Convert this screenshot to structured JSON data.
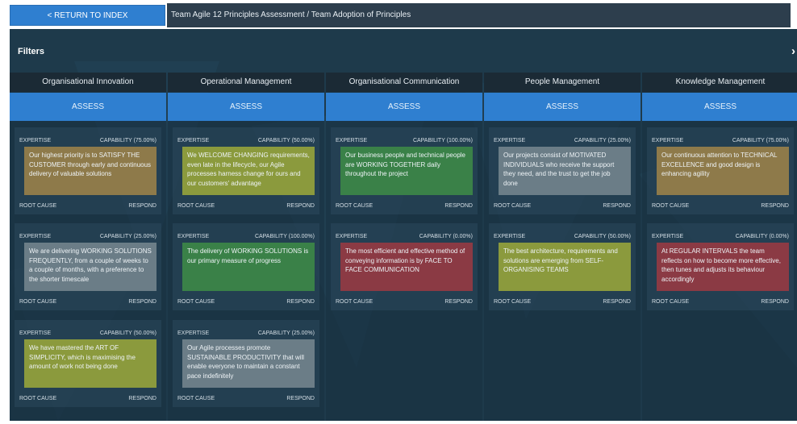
{
  "header": {
    "return_label": "< RETURN TO INDEX",
    "breadcrumb": "Team Agile 12 Principles Assessment / Team Adoption of Principles"
  },
  "filters": {
    "label": "Filters",
    "chevron": "›"
  },
  "labels": {
    "assess": "ASSESS",
    "expertise": "EXPERTISE",
    "root_cause": "ROOT CAUSE",
    "respond": "RESPOND"
  },
  "colors": {
    "blue": "#2f7fd0",
    "background": "#1e3a4b",
    "yellow": "#8b9a3d",
    "orange": "#8e7a4a",
    "green": "#3a8148",
    "red": "#8b3a44",
    "gray": "#6b7d87"
  },
  "columns": [
    {
      "title": "Organisational Innovation",
      "cards": [
        {
          "capability": "CAPABILITY (75.00%)",
          "statement": "Our highest priority is to SATISFY THE CUSTOMER through early and continuous delivery of valuable solutions",
          "color": "#8e7a4a"
        },
        {
          "capability": "CAPABILITY (25.00%)",
          "statement": "We are delivering WORKING SOLUTIONS FREQUENTLY, from a couple of weeks to a couple of months, with a preference to the shorter timescale",
          "color": "#6b7d87"
        },
        {
          "capability": "CAPABILITY (50.00%)",
          "statement": "We have mastered the ART OF SIMPLICITY, which is maximising the amount of work not being done",
          "color": "#8b9a3d"
        }
      ]
    },
    {
      "title": "Operational Management",
      "cards": [
        {
          "capability": "CAPABILITY (50.00%)",
          "statement": "We WELCOME CHANGING requirements, even late in the lifecycle, our Agile processes harness change for ours and our customers' advantage",
          "color": "#8b9a3d"
        },
        {
          "capability": "CAPABILITY (100.00%)",
          "statement": "The delivery of WORKING SOLUTIONS is our primary measure of progress",
          "color": "#3a8148"
        },
        {
          "capability": "CAPABILITY (25.00%)",
          "statement": "Our Agile processes promote SUSTAINABLE PRODUCTIVITY that will enable everyone to maintain a constant pace indefinitely",
          "color": "#6b7d87"
        }
      ]
    },
    {
      "title": "Organisational Communication",
      "cards": [
        {
          "capability": "CAPABILITY (100.00%)",
          "statement": "Our business people and technical people are WORKING TOGETHER daily throughout the project",
          "color": "#3a8148"
        },
        {
          "capability": "CAPABILITY (0.00%)",
          "statement": "The most efficient and effective method of conveying information is by FACE TO FACE COMMUNICATION",
          "color": "#8b3a44"
        }
      ]
    },
    {
      "title": "People Management",
      "cards": [
        {
          "capability": "CAPABILITY (25.00%)",
          "statement": "Our projects consist of MOTIVATED INDIVIDUALS who receive the support they need, and the trust to get the job done",
          "color": "#6b7d87"
        },
        {
          "capability": "CAPABILITY (50.00%)",
          "statement": "The best architecture, requirements and solutions are emerging from SELF-ORGANISING TEAMS",
          "color": "#8b9a3d"
        }
      ]
    },
    {
      "title": "Knowledge Management",
      "cards": [
        {
          "capability": "CAPABILITY (75.00%)",
          "statement": "Our continuous attention to TECHNICAL EXCELLENCE and good design is enhancing agility",
          "color": "#8e7a4a"
        },
        {
          "capability": "CAPABILITY (0.00%)",
          "statement": "At REGULAR INTERVALS the team reflects on how to become more effective, then tunes and adjusts its behaviour accordingly",
          "color": "#8b3a44"
        }
      ]
    }
  ]
}
